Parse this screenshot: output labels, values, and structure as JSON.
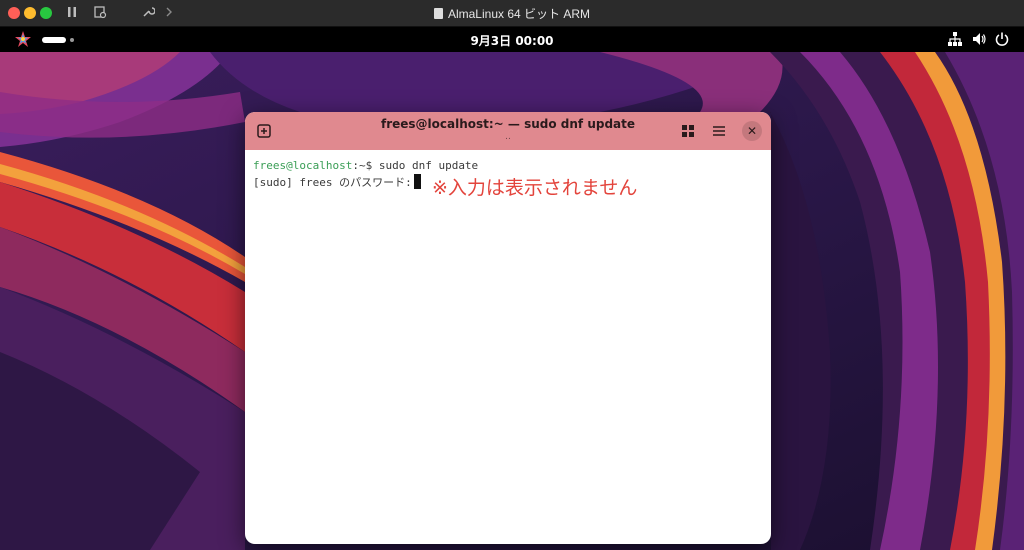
{
  "host": {
    "window_title": "AlmaLinux 64 ビット ARM"
  },
  "gnome": {
    "clock": "9月3日  00:00"
  },
  "terminal": {
    "title": "frees@localhost:~ — sudo dnf update",
    "subtitle": "..",
    "lines": {
      "prompt_user": "frees@localhost",
      "prompt_sep": ":~$ ",
      "command": "sudo dnf update",
      "password_prompt": "[sudo] frees のパスワード:"
    }
  },
  "annotation": {
    "text": "※入力は表示されません",
    "color": "#e3443c"
  },
  "colors": {
    "terminal_header": "#e0898f",
    "prompt_green": "#3a9e56"
  },
  "icons": {
    "activities": "fedora-like-logo-icon",
    "network": "network-wired-icon",
    "volume": "speaker-icon",
    "power": "power-icon"
  }
}
